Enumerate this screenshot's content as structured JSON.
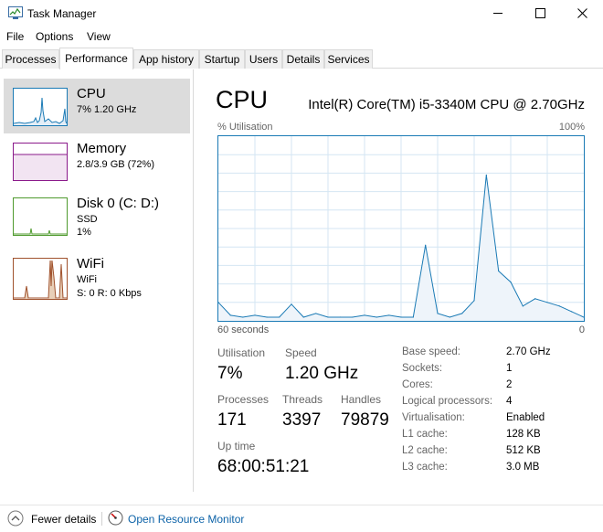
{
  "window": {
    "title": "Task Manager"
  },
  "menu": [
    "File",
    "Options",
    "View"
  ],
  "tabs": [
    "Processes",
    "Performance",
    "App history",
    "Startup",
    "Users",
    "Details",
    "Services"
  ],
  "sidebar": [
    {
      "title": "CPU",
      "lines": [
        "7%  1.20 GHz"
      ]
    },
    {
      "title": "Memory",
      "lines": [
        "2.8/3.9 GB (72%)"
      ]
    },
    {
      "title": "Disk 0 (C: D:)",
      "lines": [
        "SSD",
        "1%"
      ]
    },
    {
      "title": "WiFi",
      "lines": [
        "WiFi",
        "S: 0  R: 0 Kbps"
      ]
    }
  ],
  "main": {
    "title": "CPU",
    "model": "Intel(R) Core(TM) i5-3340M CPU @ 2.70GHz",
    "util_label": "% Utilisation",
    "util_max": "100%",
    "time_label": "60 seconds",
    "time_zero": "0"
  },
  "stats": {
    "utilisation_label": "Utilisation",
    "utilisation": "7%",
    "speed_label": "Speed",
    "speed": "1.20 GHz",
    "processes_label": "Processes",
    "processes": "171",
    "threads_label": "Threads",
    "threads": "3397",
    "handles_label": "Handles",
    "handles": "79879",
    "uptime_label": "Up time",
    "uptime": "68:00:51:21"
  },
  "info": [
    {
      "label": "Base speed:",
      "value": "2.70 GHz"
    },
    {
      "label": "Sockets:",
      "value": "1"
    },
    {
      "label": "Cores:",
      "value": "2"
    },
    {
      "label": "Logical processors:",
      "value": "4"
    },
    {
      "label": "Virtualisation:",
      "value": "Enabled"
    },
    {
      "label": "L1 cache:",
      "value": "128 KB"
    },
    {
      "label": "L2 cache:",
      "value": "512 KB"
    },
    {
      "label": "L3 cache:",
      "value": "3.0 MB"
    }
  ],
  "footer": {
    "fewer_details": "Fewer details",
    "resource_monitor": "Open Resource Monitor"
  },
  "chart_data": {
    "type": "area",
    "x": [
      60,
      58,
      56,
      54,
      52,
      50,
      48,
      46,
      44,
      42,
      40,
      38,
      36,
      34,
      32,
      30,
      28,
      26,
      24,
      22,
      20,
      18,
      16,
      14,
      12,
      10,
      8,
      6,
      4,
      2,
      0
    ],
    "values": [
      10,
      3,
      2,
      3,
      2,
      2,
      9,
      2,
      4,
      2,
      2,
      2,
      3,
      2,
      3,
      2,
      2,
      41,
      4,
      2,
      4,
      11,
      79,
      27,
      21,
      8,
      12,
      10,
      8,
      5,
      2
    ],
    "ylim": [
      0,
      100
    ],
    "colors": {
      "line": "#1a7ab5",
      "fill": "#eef4fa",
      "grid": "#d4e6f3"
    }
  }
}
